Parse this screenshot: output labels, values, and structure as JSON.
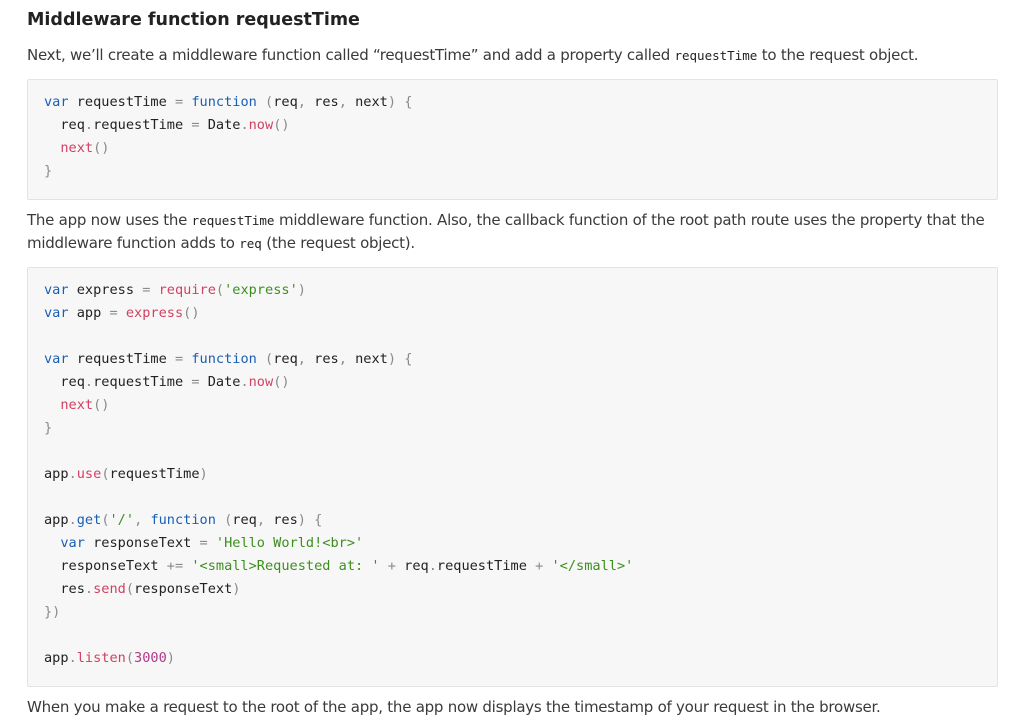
{
  "heading": "Middleware function requestTime",
  "intro": {
    "before": "Next, we’ll create a middleware function called “requestTime” and add a property called ",
    "code": "requestTime",
    "after": " to the request object."
  },
  "explain": {
    "before": "The app now uses the ",
    "code1": "requestTime",
    "middle": " middleware function. Also, the callback function of the root path route uses the property that the middleware function adds to ",
    "code2": "req",
    "after": " (the request object)."
  },
  "outro": "When you make a request to the root of the app, the app now displays the timestamp of your request in the browser.",
  "code_block_1": [
    [
      [
        "kw",
        "var"
      ],
      [
        "tx",
        " requestTime "
      ],
      [
        "op",
        "="
      ],
      [
        "tx",
        " "
      ],
      [
        "kw",
        "function"
      ],
      [
        "tx",
        " "
      ],
      [
        "pn",
        "("
      ],
      [
        "tx",
        "req"
      ],
      [
        "pn",
        ","
      ],
      [
        "tx",
        " res"
      ],
      [
        "pn",
        ","
      ],
      [
        "tx",
        " next"
      ],
      [
        "pn",
        ")"
      ],
      [
        "tx",
        " "
      ],
      [
        "pn",
        "{"
      ]
    ],
    [
      [
        "tx",
        "  req"
      ],
      [
        "pn",
        "."
      ],
      [
        "tx",
        "requestTime "
      ],
      [
        "op",
        "="
      ],
      [
        "tx",
        " Date"
      ],
      [
        "pn",
        "."
      ],
      [
        "fn",
        "now"
      ],
      [
        "pn",
        "()"
      ]
    ],
    [
      [
        "tx",
        "  "
      ],
      [
        "fn",
        "next"
      ],
      [
        "pn",
        "()"
      ]
    ],
    [
      [
        "pn",
        "}"
      ]
    ]
  ],
  "code_block_2": [
    [
      [
        "kw",
        "var"
      ],
      [
        "tx",
        " express "
      ],
      [
        "op",
        "="
      ],
      [
        "tx",
        " "
      ],
      [
        "fn",
        "require"
      ],
      [
        "pn",
        "("
      ],
      [
        "str",
        "'express'"
      ],
      [
        "pn",
        ")"
      ]
    ],
    [
      [
        "kw",
        "var"
      ],
      [
        "tx",
        " app "
      ],
      [
        "op",
        "="
      ],
      [
        "tx",
        " "
      ],
      [
        "fn",
        "express"
      ],
      [
        "pn",
        "()"
      ]
    ],
    [],
    [
      [
        "kw",
        "var"
      ],
      [
        "tx",
        " requestTime "
      ],
      [
        "op",
        "="
      ],
      [
        "tx",
        " "
      ],
      [
        "kw",
        "function"
      ],
      [
        "tx",
        " "
      ],
      [
        "pn",
        "("
      ],
      [
        "tx",
        "req"
      ],
      [
        "pn",
        ","
      ],
      [
        "tx",
        " res"
      ],
      [
        "pn",
        ","
      ],
      [
        "tx",
        " next"
      ],
      [
        "pn",
        ")"
      ],
      [
        "tx",
        " "
      ],
      [
        "pn",
        "{"
      ]
    ],
    [
      [
        "tx",
        "  req"
      ],
      [
        "pn",
        "."
      ],
      [
        "tx",
        "requestTime "
      ],
      [
        "op",
        "="
      ],
      [
        "tx",
        " Date"
      ],
      [
        "pn",
        "."
      ],
      [
        "fn",
        "now"
      ],
      [
        "pn",
        "()"
      ]
    ],
    [
      [
        "tx",
        "  "
      ],
      [
        "fn",
        "next"
      ],
      [
        "pn",
        "()"
      ]
    ],
    [
      [
        "pn",
        "}"
      ]
    ],
    [],
    [
      [
        "tx",
        "app"
      ],
      [
        "pn",
        "."
      ],
      [
        "fn",
        "use"
      ],
      [
        "pn",
        "("
      ],
      [
        "tx",
        "requestTime"
      ],
      [
        "pn",
        ")"
      ]
    ],
    [],
    [
      [
        "tx",
        "app"
      ],
      [
        "pn",
        "."
      ],
      [
        "kw",
        "get"
      ],
      [
        "pn",
        "("
      ],
      [
        "str",
        "'/'"
      ],
      [
        "pn",
        ","
      ],
      [
        "tx",
        " "
      ],
      [
        "kw",
        "function"
      ],
      [
        "tx",
        " "
      ],
      [
        "pn",
        "("
      ],
      [
        "tx",
        "req"
      ],
      [
        "pn",
        ","
      ],
      [
        "tx",
        " res"
      ],
      [
        "pn",
        ")"
      ],
      [
        "tx",
        " "
      ],
      [
        "pn",
        "{"
      ]
    ],
    [
      [
        "tx",
        "  "
      ],
      [
        "kw",
        "var"
      ],
      [
        "tx",
        " responseText "
      ],
      [
        "op",
        "="
      ],
      [
        "tx",
        " "
      ],
      [
        "str",
        "'Hello World!<br>'"
      ]
    ],
    [
      [
        "tx",
        "  responseText "
      ],
      [
        "op",
        "+="
      ],
      [
        "tx",
        " "
      ],
      [
        "str",
        "'<small>Requested at: '"
      ],
      [
        "tx",
        " "
      ],
      [
        "op",
        "+"
      ],
      [
        "tx",
        " req"
      ],
      [
        "pn",
        "."
      ],
      [
        "tx",
        "requestTime "
      ],
      [
        "op",
        "+"
      ],
      [
        "tx",
        " "
      ],
      [
        "str",
        "'</small>'"
      ]
    ],
    [
      [
        "tx",
        "  res"
      ],
      [
        "pn",
        "."
      ],
      [
        "fn",
        "send"
      ],
      [
        "pn",
        "("
      ],
      [
        "tx",
        "responseText"
      ],
      [
        "pn",
        ")"
      ]
    ],
    [
      [
        "pn",
        "})"
      ]
    ],
    [],
    [
      [
        "tx",
        "app"
      ],
      [
        "pn",
        "."
      ],
      [
        "fn",
        "listen"
      ],
      [
        "pn",
        "("
      ],
      [
        "num",
        "3000"
      ],
      [
        "pn",
        ")"
      ]
    ]
  ]
}
